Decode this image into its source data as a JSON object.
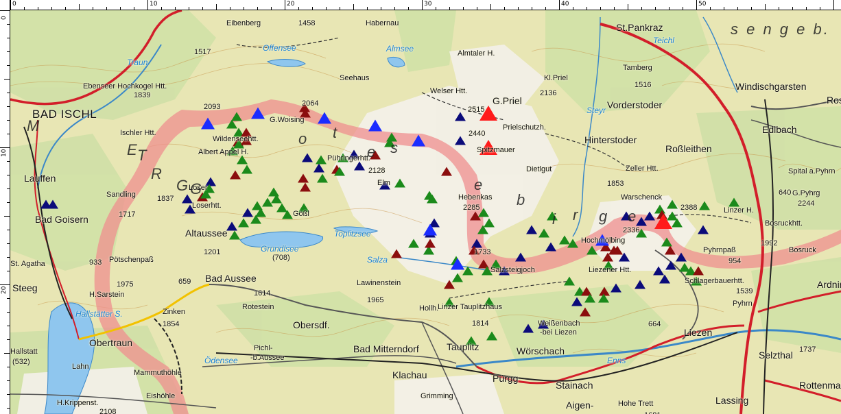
{
  "ruler": {
    "top_labels": [
      "0",
      "10",
      "20",
      "30",
      "40",
      "50"
    ],
    "left_labels": [
      "0",
      "10",
      "20"
    ]
  },
  "colors": {
    "map_bg": "#e8e6b4",
    "forest": "#cfe0a6",
    "rock": "#f4f1ea",
    "water": "#8fc6ee",
    "park_boundary": "#ef8f8f",
    "motorway": "#d21e2a",
    "green_marker": "#1b8a1b",
    "darkred_marker": "#8b0e0e",
    "navy_marker": "#0b0b7a",
    "blue_marker": "#1a2cff",
    "red_marker": "#ff1a1a"
  },
  "labels": [
    {
      "id": "bad-ischl",
      "text": "BAD ISCHL",
      "cls": "big"
    },
    {
      "id": "ebensee",
      "text": "Ebenseer Hochkogel Htt.",
      "cls": "small"
    },
    {
      "id": "e1839",
      "text": "1839",
      "cls": "small"
    },
    {
      "id": "e1517",
      "text": "1517",
      "cls": "small"
    },
    {
      "id": "e1458",
      "text": "1458",
      "cls": "small"
    },
    {
      "id": "eibenberg",
      "text": "Eibenberg",
      "cls": "small"
    },
    {
      "id": "habernau",
      "text": "Habernau",
      "cls": "small"
    },
    {
      "id": "offensee",
      "text": "Offensee",
      "cls": "water"
    },
    {
      "id": "almsee",
      "text": "Almsee",
      "cls": "water"
    },
    {
      "id": "traun",
      "text": "Traun",
      "cls": "water"
    },
    {
      "id": "almtaler",
      "text": "Almtaler H.",
      "cls": "small"
    },
    {
      "id": "seehaus",
      "text": "Seehaus",
      "cls": "small"
    },
    {
      "id": "welser",
      "text": "Welser Htt.",
      "cls": "small"
    },
    {
      "id": "gpriel",
      "text": "G.Priel",
      "cls": "town"
    },
    {
      "id": "e2515",
      "text": "2515",
      "cls": "small"
    },
    {
      "id": "e2440",
      "text": "2440",
      "cls": "small"
    },
    {
      "id": "prielschutz",
      "text": "Prielschutzh.",
      "cls": "small"
    },
    {
      "id": "spitzmauer",
      "text": "Spitzmauer",
      "cls": "small"
    },
    {
      "id": "klpriel",
      "text": "Kl.Priel",
      "cls": "small"
    },
    {
      "id": "e2136",
      "text": "2136",
      "cls": "small"
    },
    {
      "id": "stpankraz",
      "text": "St.Pankraz",
      "cls": "town"
    },
    {
      "id": "teichl",
      "text": "Teichl",
      "cls": "water"
    },
    {
      "id": "tamberg",
      "text": "Tamberg",
      "cls": "small"
    },
    {
      "id": "e1516",
      "text": "1516",
      "cls": "small"
    },
    {
      "id": "windisch",
      "text": "Windischgarsten",
      "cls": "town"
    },
    {
      "id": "vorderstoder",
      "text": "Vorderstoder",
      "cls": "town"
    },
    {
      "id": "steyr",
      "text": "Steyr",
      "cls": "water"
    },
    {
      "id": "edlbach",
      "text": "Edlbach",
      "cls": "town"
    },
    {
      "id": "ros",
      "text": "Ros",
      "cls": "town"
    },
    {
      "id": "hinterstoder",
      "text": "Hinterstoder",
      "cls": "town"
    },
    {
      "id": "rossleithen",
      "text": "Roßleithen",
      "cls": "town"
    },
    {
      "id": "zeller",
      "text": "Zeller Htt.",
      "cls": "small"
    },
    {
      "id": "dietlgut",
      "text": "Dietlgut",
      "cls": "small"
    },
    {
      "id": "spital",
      "text": "Spital a.Pyhrn",
      "cls": "small"
    },
    {
      "id": "gpyhrg",
      "text": "G.Pyhrg",
      "cls": "small"
    },
    {
      "id": "e2244",
      "text": "2244",
      "cls": "small"
    },
    {
      "id": "e1853",
      "text": "1853",
      "cls": "small"
    },
    {
      "id": "warschen",
      "text": "Warschenck",
      "cls": "small"
    },
    {
      "id": "e2388",
      "text": "2388",
      "cls": "small"
    },
    {
      "id": "linzer",
      "text": "Linzer H.",
      "cls": "small"
    },
    {
      "id": "bosruckhtt",
      "text": "Bosruckhtt.",
      "cls": "small"
    },
    {
      "id": "e640",
      "text": "640",
      "cls": "small"
    },
    {
      "id": "e1992",
      "text": "1992",
      "cls": "small"
    },
    {
      "id": "bosruck",
      "text": "Bosruck",
      "cls": "small"
    },
    {
      "id": "pyhrnpass",
      "text": "Pyhrnpaß",
      "cls": "small"
    },
    {
      "id": "e954",
      "text": "954",
      "cls": "small"
    },
    {
      "id": "schlager",
      "text": "Schlagerbauerhtt.",
      "cls": "small"
    },
    {
      "id": "e1539",
      "text": "1539",
      "cls": "small"
    },
    {
      "id": "pyhrn",
      "text": "Pyhrn",
      "cls": "small"
    },
    {
      "id": "ardning",
      "text": "Ardning",
      "cls": "town"
    },
    {
      "id": "hochmolbing",
      "text": "Hochmölbing",
      "cls": "small"
    },
    {
      "id": "e2336",
      "text": "2336",
      "cls": "small"
    },
    {
      "id": "liezenerhtt",
      "text": "Liezener Htt.",
      "cls": "small"
    },
    {
      "id": "liezen",
      "text": "Liezen",
      "cls": "town"
    },
    {
      "id": "e664",
      "text": "664",
      "cls": "small"
    },
    {
      "id": "weissenbach",
      "text": "Weißenbach",
      "cls": "small"
    },
    {
      "id": "beiliezen",
      "text": "-bei Liezen",
      "cls": "small"
    },
    {
      "id": "selzthal",
      "text": "Selzthal",
      "cls": "town"
    },
    {
      "id": "e1737",
      "text": "1737",
      "cls": "small"
    },
    {
      "id": "rottenmann",
      "text": "Rottenma",
      "cls": "town"
    },
    {
      "id": "enns",
      "text": "Enns",
      "cls": "water"
    },
    {
      "id": "gwoising",
      "text": "G.Woising",
      "cls": "small"
    },
    {
      "id": "e2093",
      "text": "2093",
      "cls": "small"
    },
    {
      "id": "e2064",
      "text": "2064",
      "cls": "small"
    },
    {
      "id": "ischler",
      "text": "Ischler Htt.",
      "cls": "small"
    },
    {
      "id": "wildensee",
      "text": "Wildenseehtt.",
      "cls": "small"
    },
    {
      "id": "albert",
      "text": "Albert Appel H.",
      "cls": "small"
    },
    {
      "id": "pihringer",
      "text": "Pühringerhtt.",
      "cls": "small"
    },
    {
      "id": "e2128",
      "text": "2128",
      "cls": "small"
    },
    {
      "id": "elm",
      "text": "Elm",
      "cls": "small"
    },
    {
      "id": "hebenkas",
      "text": "Hebenkas",
      "cls": "small"
    },
    {
      "id": "e2285",
      "text": "2285",
      "cls": "small"
    },
    {
      "id": "lauffen",
      "text": "Lauffen",
      "cls": "town"
    },
    {
      "id": "sandling",
      "text": "Sandling",
      "cls": "small"
    },
    {
      "id": "e1717",
      "text": "1717",
      "cls": "small"
    },
    {
      "id": "loser",
      "text": "Loser",
      "cls": "small"
    },
    {
      "id": "e1837",
      "text": "1837",
      "cls": "small"
    },
    {
      "id": "loserhtt",
      "text": "Loserhtt.",
      "cls": "small"
    },
    {
      "id": "badgoisern",
      "text": "Bad Goisern",
      "cls": "town"
    },
    {
      "id": "altaussee",
      "text": "Altaussee",
      "cls": "town"
    },
    {
      "id": "gossl",
      "text": "Gößl",
      "cls": "small"
    },
    {
      "id": "toplitzsee",
      "text": "Toplitzsee",
      "cls": "water"
    },
    {
      "id": "grundlsee",
      "text": "Grundlsee",
      "cls": "water"
    },
    {
      "id": "e708",
      "text": "(708)",
      "cls": "small"
    },
    {
      "id": "e1201",
      "text": "1201",
      "cls": "small"
    },
    {
      "id": "salza",
      "text": "Salza",
      "cls": "water"
    },
    {
      "id": "e1733",
      "text": "1733",
      "cls": "small"
    },
    {
      "id": "salzsteigjoch",
      "text": "Salzsteigjoch",
      "cls": "small"
    },
    {
      "id": "stagatha",
      "text": "St. Agatha",
      "cls": "small"
    },
    {
      "id": "e933",
      "text": "933",
      "cls": "small"
    },
    {
      "id": "potschen",
      "text": "Pötschenpaß",
      "cls": "small"
    },
    {
      "id": "e1975",
      "text": "1975",
      "cls": "small"
    },
    {
      "id": "e659",
      "text": "659",
      "cls": "small"
    },
    {
      "id": "badaussee",
      "text": "Bad Aussee",
      "cls": "town"
    },
    {
      "id": "steeg",
      "text": "Steeg",
      "cls": "town"
    },
    {
      "id": "hsarstein",
      "text": "H.Sarstein",
      "cls": "small"
    },
    {
      "id": "e1614",
      "text": "1614",
      "cls": "small"
    },
    {
      "id": "rotestein",
      "text": "Rotestein",
      "cls": "small"
    },
    {
      "id": "lawinenstein",
      "text": "Lawinenstein",
      "cls": "small"
    },
    {
      "id": "e1965",
      "text": "1965",
      "cls": "small"
    },
    {
      "id": "hollh",
      "text": "Hollh.",
      "cls": "small"
    },
    {
      "id": "linzertaupl",
      "text": "Linzer Tauplitzhaus",
      "cls": "small"
    },
    {
      "id": "e1814",
      "text": "1814",
      "cls": "small"
    },
    {
      "id": "hallstatter",
      "text": "Hallstätter S.",
      "cls": "water"
    },
    {
      "id": "zinken",
      "text": "Zinken",
      "cls": "small"
    },
    {
      "id": "e1854",
      "text": "1854",
      "cls": "small"
    },
    {
      "id": "obersdf",
      "text": "Obersdf.",
      "cls": "town"
    },
    {
      "id": "obertraun",
      "text": "Obertraun",
      "cls": "town"
    },
    {
      "id": "hallstatt",
      "text": "Hallstatt",
      "cls": "small"
    },
    {
      "id": "e532",
      "text": "(532)",
      "cls": "small"
    },
    {
      "id": "lahn",
      "text": "Lahn",
      "cls": "small"
    },
    {
      "id": "odensee",
      "text": "Ödensee",
      "cls": "water"
    },
    {
      "id": "pichl",
      "text": "Pichl-",
      "cls": "small"
    },
    {
      "id": "baussee",
      "text": "-b.Aussee",
      "cls": "small"
    },
    {
      "id": "badmitterndorf",
      "text": "Bad Mitterndorf",
      "cls": "town"
    },
    {
      "id": "tauplitz",
      "text": "Tauplitz",
      "cls": "town"
    },
    {
      "id": "worschach",
      "text": "Wörschach",
      "cls": "town"
    },
    {
      "id": "klachau",
      "text": "Klachau",
      "cls": "town"
    },
    {
      "id": "purgg",
      "text": "Pürgg",
      "cls": "town"
    },
    {
      "id": "stainach",
      "text": "Stainach",
      "cls": "town"
    },
    {
      "id": "aigen",
      "text": "Aigen-",
      "cls": "town"
    },
    {
      "id": "grimming",
      "text": "Grimming",
      "cls": "small"
    },
    {
      "id": "mammuth",
      "text": "Mammuthöhle",
      "cls": "small"
    },
    {
      "id": "eishohle",
      "text": "Eishöhle",
      "cls": "small"
    },
    {
      "id": "e2108",
      "text": "2108",
      "cls": "small"
    },
    {
      "id": "hkrippen",
      "text": "H.Krippenst.",
      "cls": "small"
    },
    {
      "id": "hohetrett",
      "text": "Hohe Trett",
      "cls": "small"
    },
    {
      "id": "e1681",
      "text": "1681",
      "cls": "small"
    },
    {
      "id": "lassing",
      "text": "Lassing",
      "cls": "town"
    },
    {
      "id": "t-g",
      "text": "T",
      "cls": "region"
    },
    {
      "id": "o-g",
      "text": "o",
      "cls": "region"
    },
    {
      "id": "t2-g",
      "text": "t",
      "cls": "region"
    },
    {
      "id": "e-g",
      "text": "e",
      "cls": "region"
    },
    {
      "id": "s-g",
      "text": "s",
      "cls": "region"
    },
    {
      "id": "g-g",
      "text": "G",
      "cls": "region"
    },
    {
      "id": "e2-g",
      "text": "e",
      "cls": "region"
    },
    {
      "id": "b-g",
      "text": "b",
      "cls": "region"
    },
    {
      "id": "i-g",
      "text": "i",
      "cls": "region"
    },
    {
      "id": "r-g",
      "text": "r",
      "cls": "region"
    },
    {
      "id": "g2-g",
      "text": "g",
      "cls": "region"
    },
    {
      "id": "e3-g",
      "text": "e",
      "cls": "region"
    },
    {
      "id": "m-g",
      "text": "M",
      "cls": "region"
    },
    {
      "id": "e4-g",
      "text": "E",
      "cls": "region"
    },
    {
      "id": "r2-g",
      "text": "R",
      "cls": "region"
    },
    {
      "id": "g3-g",
      "text": "G",
      "cls": "region"
    },
    {
      "id": "s2-g",
      "text": "s e n g e b.",
      "cls": "region"
    }
  ],
  "markers": [
    {
      "c": "navy",
      "s": "s"
    },
    {
      "c": "navy",
      "s": "s"
    },
    {
      "c": "blue",
      "s": "m"
    },
    {
      "c": "blue",
      "s": "m"
    },
    {
      "c": "darkred",
      "s": "s"
    },
    {
      "c": "blue",
      "s": "m"
    },
    {
      "c": "blue",
      "s": "m"
    },
    {
      "c": "blue",
      "s": "m"
    },
    {
      "c": "red",
      "s": "l"
    },
    {
      "c": "red",
      "s": "l"
    },
    {
      "c": "navy",
      "s": "s"
    },
    {
      "c": "navy",
      "s": "s"
    },
    {
      "c": "green",
      "s": "s"
    },
    {
      "c": "navy",
      "s": "s"
    },
    {
      "c": "green",
      "s": "s"
    },
    {
      "c": "green",
      "s": "s"
    },
    {
      "c": "darkred",
      "s": "s"
    },
    {
      "c": "darkred",
      "s": "s"
    },
    {
      "c": "green",
      "s": "s"
    },
    {
      "c": "green",
      "s": "s"
    },
    {
      "c": "green",
      "s": "s"
    },
    {
      "c": "green",
      "s": "s"
    },
    {
      "c": "darkred",
      "s": "s"
    },
    {
      "c": "navy",
      "s": "s"
    },
    {
      "c": "navy",
      "s": "s"
    },
    {
      "c": "green",
      "s": "s"
    },
    {
      "c": "green",
      "s": "s"
    },
    {
      "c": "darkred",
      "s": "s"
    },
    {
      "c": "navy",
      "s": "s"
    },
    {
      "c": "navy",
      "s": "s"
    },
    {
      "c": "green",
      "s": "s"
    },
    {
      "c": "green",
      "s": "s"
    },
    {
      "c": "green",
      "s": "s"
    },
    {
      "c": "green",
      "s": "s"
    },
    {
      "c": "darkred",
      "s": "s"
    },
    {
      "c": "darkred",
      "s": "s"
    },
    {
      "c": "navy",
      "s": "s"
    },
    {
      "c": "navy",
      "s": "s"
    },
    {
      "c": "green",
      "s": "s"
    },
    {
      "c": "green",
      "s": "s"
    },
    {
      "c": "green",
      "s": "s"
    },
    {
      "c": "green",
      "s": "s"
    },
    {
      "c": "navy",
      "s": "s"
    },
    {
      "c": "green",
      "s": "s"
    },
    {
      "c": "green",
      "s": "s"
    },
    {
      "c": "navy",
      "s": "s"
    },
    {
      "c": "green",
      "s": "s"
    },
    {
      "c": "green",
      "s": "s"
    },
    {
      "c": "green",
      "s": "s"
    },
    {
      "c": "darkred",
      "s": "s"
    },
    {
      "c": "green",
      "s": "s"
    },
    {
      "c": "green",
      "s": "s"
    },
    {
      "c": "navy",
      "s": "s"
    },
    {
      "c": "green",
      "s": "s"
    },
    {
      "c": "darkred",
      "s": "s"
    },
    {
      "c": "green",
      "s": "s"
    },
    {
      "c": "green",
      "s": "s"
    },
    {
      "c": "navy",
      "s": "s"
    },
    {
      "c": "green",
      "s": "s"
    },
    {
      "c": "darkred",
      "s": "s"
    },
    {
      "c": "green",
      "s": "s"
    },
    {
      "c": "navy",
      "s": "s"
    },
    {
      "c": "darkred",
      "s": "s"
    },
    {
      "c": "green",
      "s": "s"
    },
    {
      "c": "green",
      "s": "s"
    },
    {
      "c": "darkred",
      "s": "s"
    },
    {
      "c": "darkred",
      "s": "s"
    },
    {
      "c": "blue",
      "s": "m"
    },
    {
      "c": "darkred",
      "s": "s"
    },
    {
      "c": "green",
      "s": "s"
    },
    {
      "c": "blue",
      "s": "m"
    },
    {
      "c": "green",
      "s": "s"
    },
    {
      "c": "green",
      "s": "s"
    },
    {
      "c": "darkred",
      "s": "s"
    },
    {
      "c": "darkred",
      "s": "s"
    },
    {
      "c": "green",
      "s": "s"
    },
    {
      "c": "green",
      "s": "s"
    },
    {
      "c": "green",
      "s": "s"
    },
    {
      "c": "navy",
      "s": "s"
    },
    {
      "c": "darkred",
      "s": "s"
    },
    {
      "c": "darkred",
      "s": "s"
    },
    {
      "c": "green",
      "s": "s"
    },
    {
      "c": "green",
      "s": "s"
    },
    {
      "c": "navy",
      "s": "s"
    },
    {
      "c": "navy",
      "s": "s"
    },
    {
      "c": "navy",
      "s": "s"
    },
    {
      "c": "green",
      "s": "s"
    },
    {
      "c": "green",
      "s": "s"
    },
    {
      "c": "green",
      "s": "s"
    },
    {
      "c": "navy",
      "s": "s"
    },
    {
      "c": "green",
      "s": "s"
    },
    {
      "c": "green",
      "s": "s"
    },
    {
      "c": "green",
      "s": "s"
    },
    {
      "c": "green",
      "s": "s"
    },
    {
      "c": "darkred",
      "s": "s"
    },
    {
      "c": "darkred",
      "s": "s"
    },
    {
      "c": "darkred",
      "s": "s"
    },
    {
      "c": "green",
      "s": "s"
    },
    {
      "c": "navy",
      "s": "s"
    },
    {
      "c": "blue",
      "s": "m"
    },
    {
      "c": "darkred",
      "s": "s"
    },
    {
      "c": "green",
      "s": "s"
    },
    {
      "c": "darkred",
      "s": "s"
    },
    {
      "c": "navy",
      "s": "s"
    },
    {
      "c": "darkred",
      "s": "s"
    },
    {
      "c": "green",
      "s": "s"
    },
    {
      "c": "darkred",
      "s": "s"
    },
    {
      "c": "navy",
      "s": "s"
    },
    {
      "c": "navy",
      "s": "s"
    },
    {
      "c": "navy",
      "s": "s"
    },
    {
      "c": "green",
      "s": "s"
    },
    {
      "c": "darkred",
      "s": "s"
    },
    {
      "c": "red",
      "s": "l"
    },
    {
      "c": "green",
      "s": "s"
    },
    {
      "c": "green",
      "s": "s"
    },
    {
      "c": "green",
      "s": "s"
    },
    {
      "c": "green",
      "s": "s"
    },
    {
      "c": "darkred",
      "s": "s"
    },
    {
      "c": "navy",
      "s": "s"
    },
    {
      "c": "navy",
      "s": "s"
    },
    {
      "c": "green",
      "s": "s"
    },
    {
      "c": "green",
      "s": "s"
    },
    {
      "c": "darkred",
      "s": "s"
    },
    {
      "c": "green",
      "s": "s"
    },
    {
      "c": "navy",
      "s": "s"
    },
    {
      "c": "navy",
      "s": "s"
    },
    {
      "c": "navy",
      "s": "s"
    },
    {
      "c": "navy",
      "s": "s"
    },
    {
      "c": "green",
      "s": "s"
    },
    {
      "c": "green",
      "s": "s"
    },
    {
      "c": "green",
      "s": "s"
    },
    {
      "c": "navy",
      "s": "s"
    },
    {
      "c": "green",
      "s": "s"
    },
    {
      "c": "green",
      "s": "s"
    },
    {
      "c": "green",
      "s": "s"
    },
    {
      "c": "green",
      "s": "s"
    },
    {
      "c": "navy",
      "s": "s"
    },
    {
      "c": "navy",
      "s": "s"
    }
  ]
}
